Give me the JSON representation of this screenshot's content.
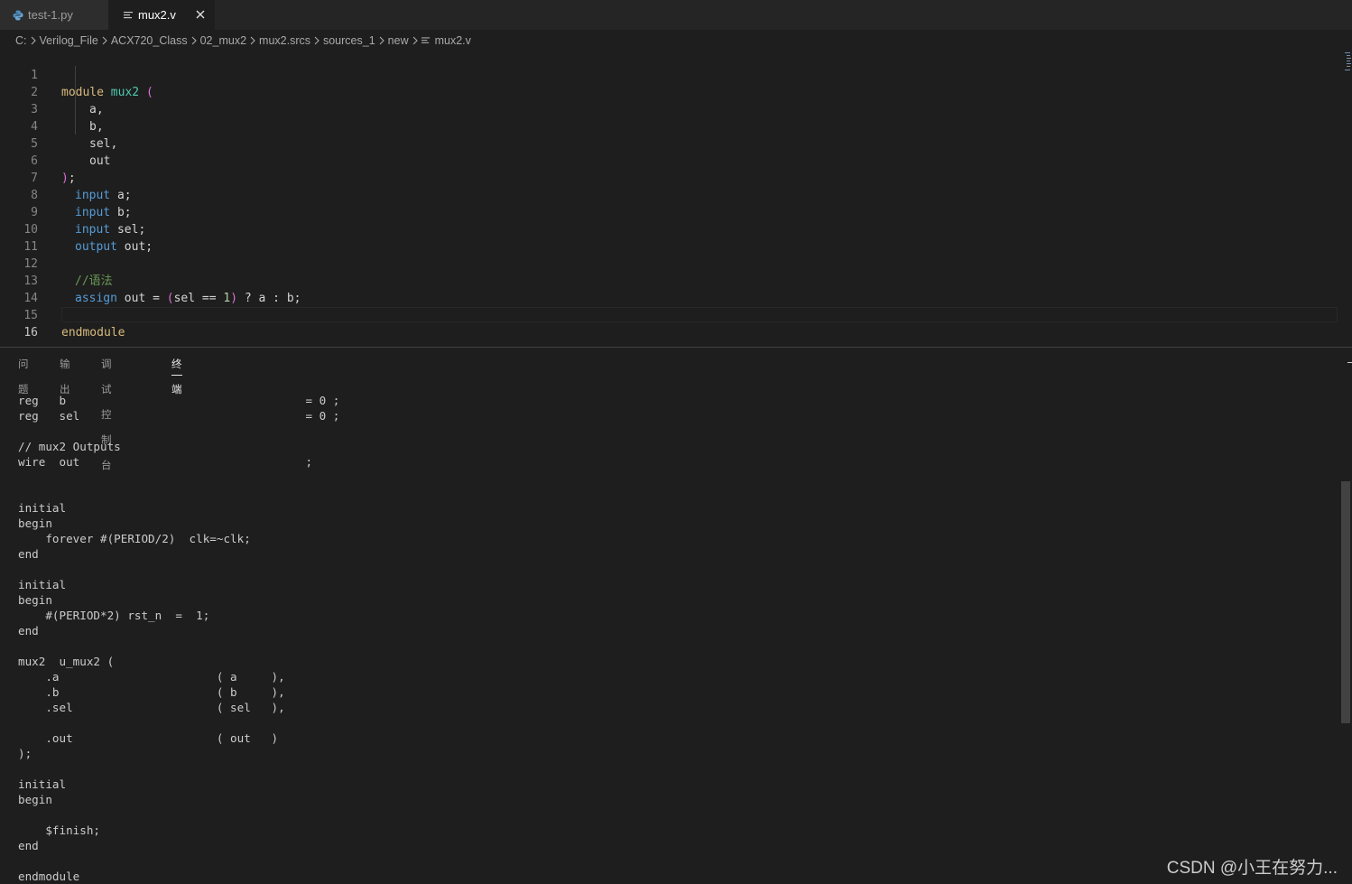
{
  "tabs": [
    {
      "label": "test-1.py",
      "icon": "python-icon",
      "active": false
    },
    {
      "label": "mux2.v",
      "icon": "file-lines-icon",
      "active": true
    }
  ],
  "breadcrumb": [
    "C:",
    "Verilog_File",
    "ACX720_Class",
    "02_mux2",
    "mux2.srcs",
    "sources_1",
    "new",
    "mux2.v"
  ],
  "editor": {
    "active_line": 16,
    "lines": [
      {
        "n": "1"
      },
      {
        "n": "2"
      },
      {
        "n": "3"
      },
      {
        "n": "4"
      },
      {
        "n": "5"
      },
      {
        "n": "6"
      },
      {
        "n": "7"
      },
      {
        "n": "8"
      },
      {
        "n": "9"
      },
      {
        "n": "10"
      },
      {
        "n": "11"
      },
      {
        "n": "12"
      },
      {
        "n": "13"
      },
      {
        "n": "14"
      },
      {
        "n": "15"
      },
      {
        "n": "16"
      }
    ],
    "code": {
      "l1_kw": "module",
      "l1_name": "mux2",
      "l1_paren": "(",
      "l2": "a,",
      "l3": "b,",
      "l4": "sel,",
      "l5": "out",
      "l6_paren": ")",
      "l6_semi": ";",
      "l7_kw": "input",
      "l7_rest": " a;",
      "l8_kw": "input",
      "l8_rest": " b;",
      "l9_kw": "input",
      "l9_rest": " sel;",
      "l10_kw": "output",
      "l10_rest": " out;",
      "l12_comment": "//语法",
      "l13_kw": "assign",
      "l13_a": " out = ",
      "l13_p1": "(",
      "l13_b": "sel == ",
      "l13_num": "1",
      "l13_p2": ")",
      "l13_c": " ? a : b;",
      "l15_kw": "endmodule"
    }
  },
  "panel": {
    "tabs": [
      {
        "label": "问题",
        "active": false
      },
      {
        "label": "输出",
        "active": false
      },
      {
        "label": "调试控制台",
        "active": false
      },
      {
        "label": "终端",
        "active": true
      }
    ]
  },
  "terminal": {
    "lines": [
      "reg   b                                   = 0 ;",
      "reg   sel                                 = 0 ;",
      "",
      "// mux2 Outputs",
      "wire  out                                 ;",
      "",
      "",
      "initial",
      "begin",
      "    forever #(PERIOD/2)  clk=~clk;",
      "end",
      "",
      "initial",
      "begin",
      "    #(PERIOD*2) rst_n  =  1;",
      "end",
      "",
      "mux2  u_mux2 (",
      "    .a                       ( a     ),",
      "    .b                       ( b     ),",
      "    .sel                     ( sel   ),",
      "",
      "    .out                     ( out   )",
      ");",
      "",
      "initial",
      "begin",
      "",
      "    $finish;",
      "end",
      "",
      "endmodule"
    ]
  },
  "watermark": "CSDN @小王在努力...",
  "colors": {
    "background": "#1e1e1e",
    "keyword": "#569cd6",
    "module": "#d7ba7d",
    "comment": "#6a9955"
  }
}
